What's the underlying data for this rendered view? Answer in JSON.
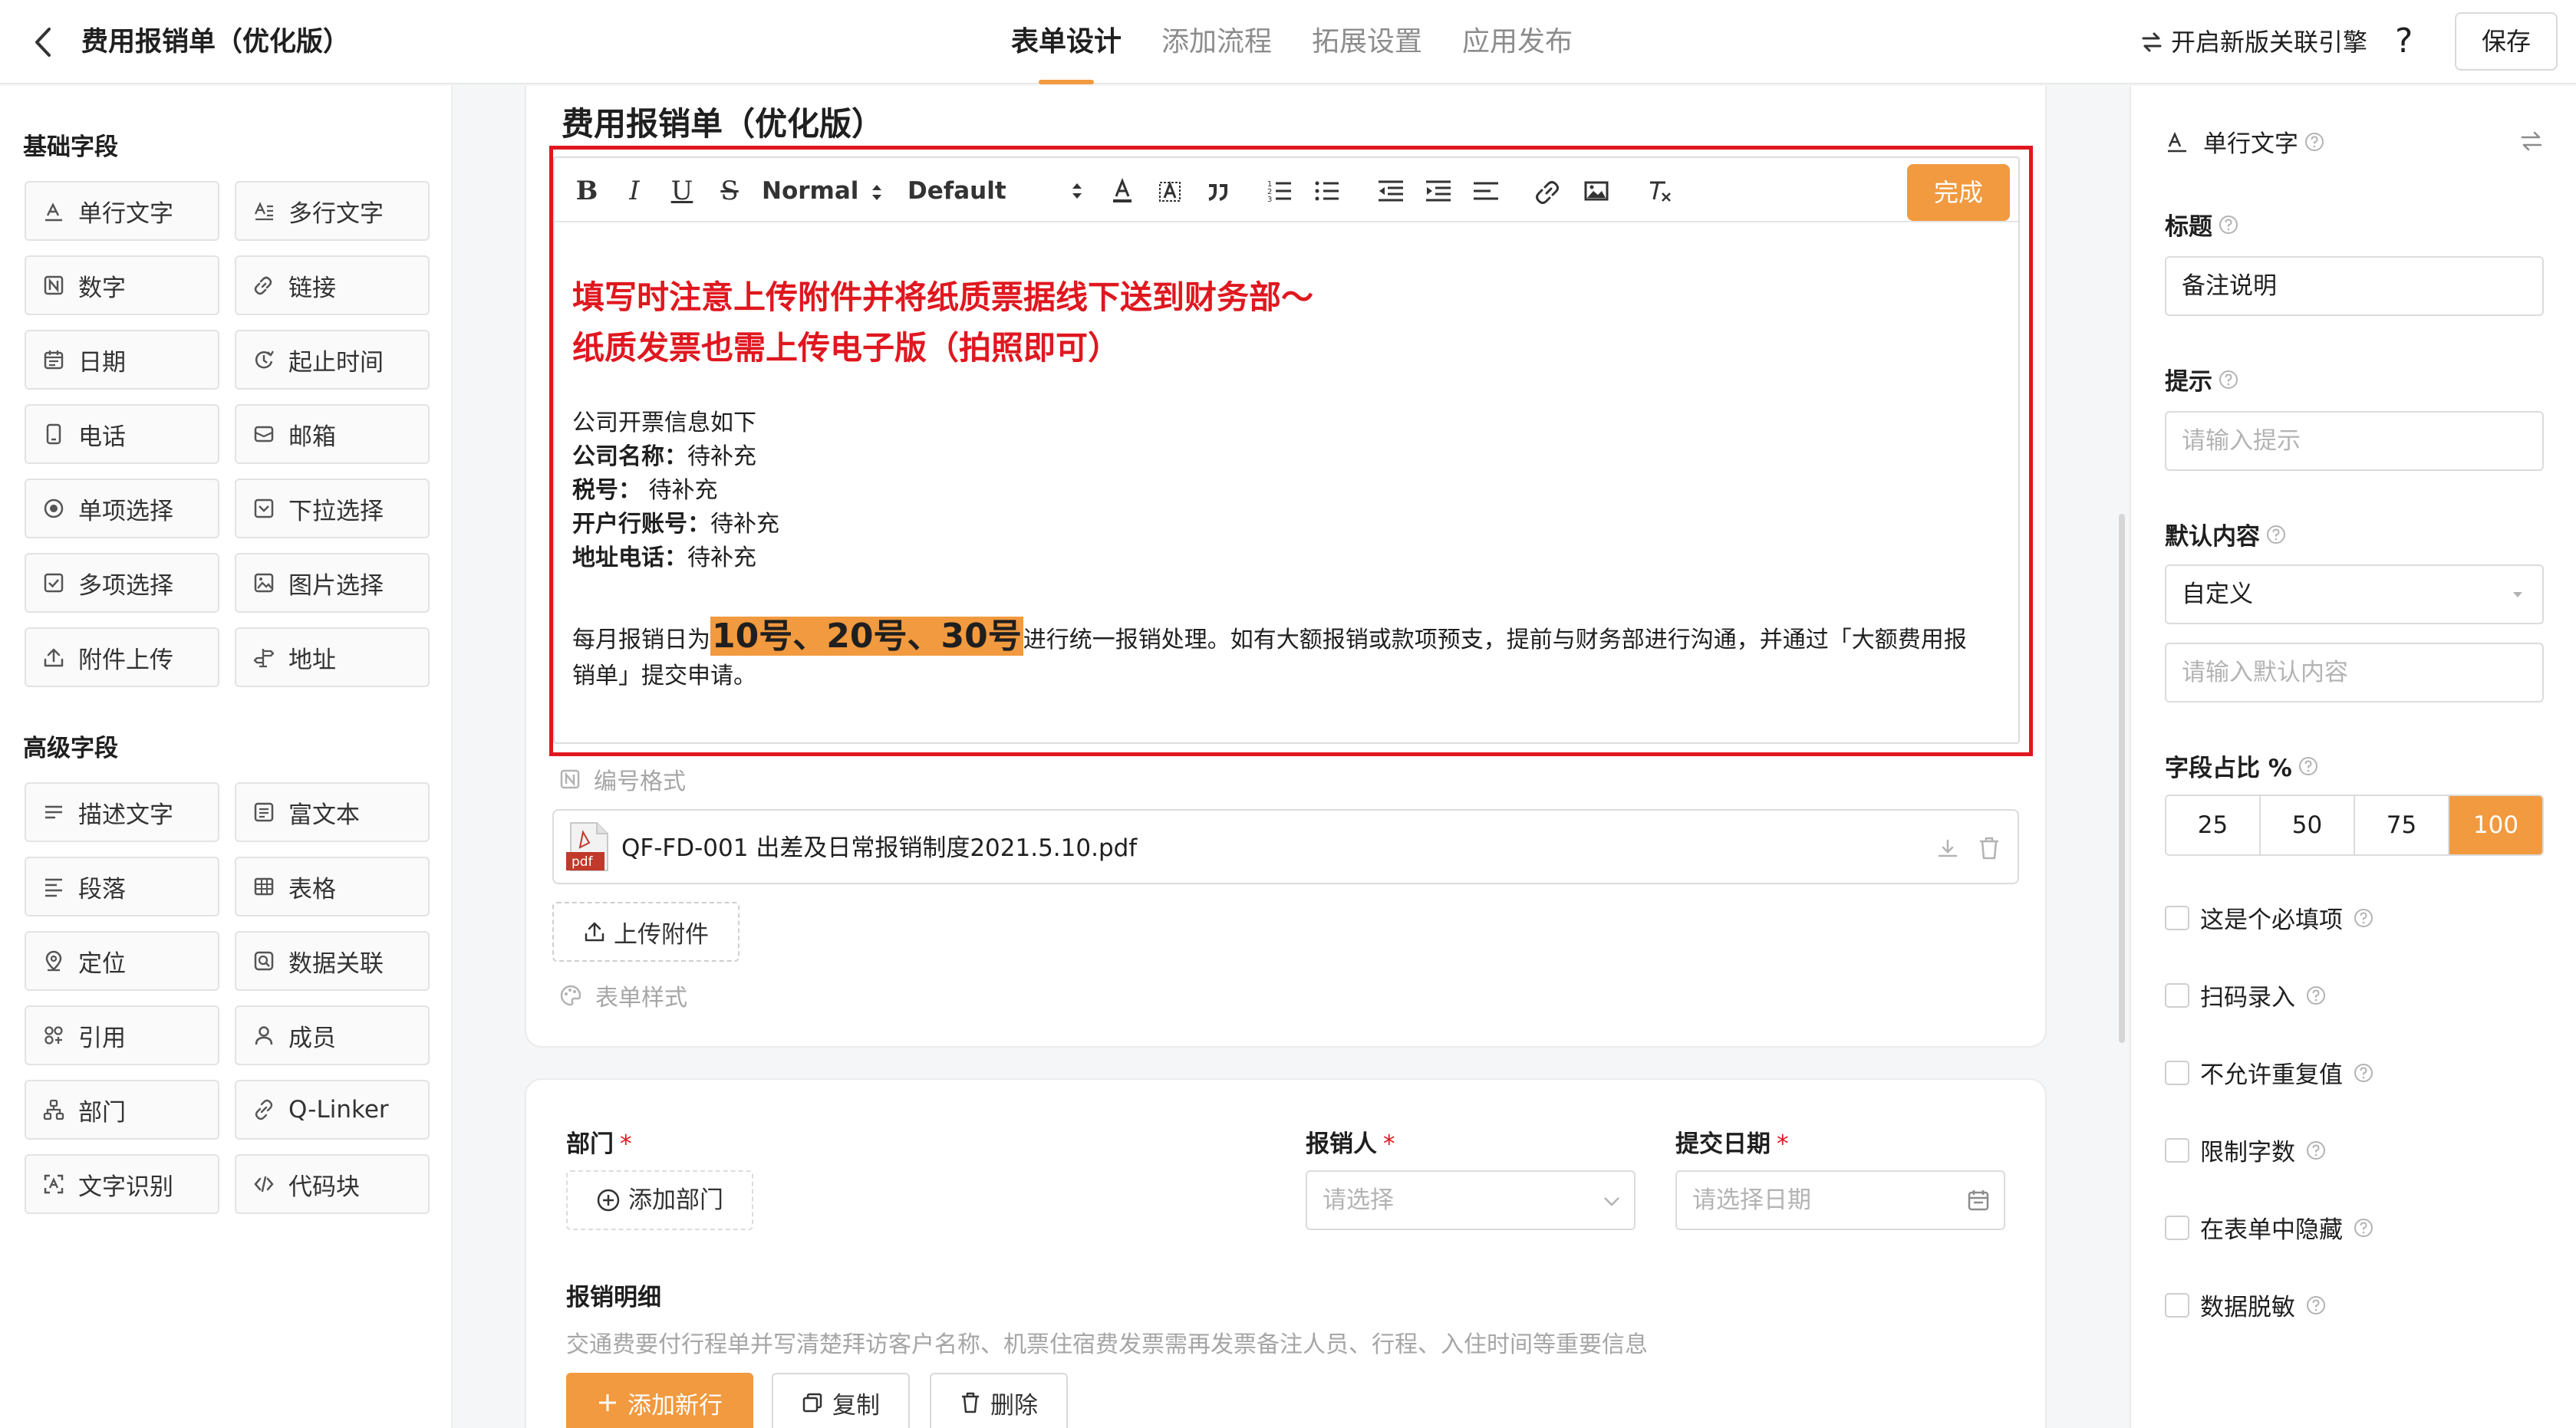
{
  "header": {
    "title": "费用报销单（优化版）",
    "tabs": [
      {
        "label": "表单设计"
      },
      {
        "label": "添加流程"
      },
      {
        "label": "拓展设置"
      },
      {
        "label": "应用发布"
      }
    ],
    "active_tab": 0,
    "engine_label": "开启新版关联引擎",
    "help_label": "?",
    "save_label": "保存"
  },
  "left_panel": {
    "basic_title": "基础字段",
    "basic_fields": [
      {
        "label": "单行文字",
        "icon": "single-line-text-icon"
      },
      {
        "label": "多行文字",
        "icon": "multi-line-text-icon"
      },
      {
        "label": "数字",
        "icon": "number-icon"
      },
      {
        "label": "链接",
        "icon": "link-icon"
      },
      {
        "label": "日期",
        "icon": "calendar-icon"
      },
      {
        "label": "起止时间",
        "icon": "time-range-icon"
      },
      {
        "label": "电话",
        "icon": "phone-icon"
      },
      {
        "label": "邮箱",
        "icon": "mail-icon"
      },
      {
        "label": "单项选择",
        "icon": "radio-icon"
      },
      {
        "label": "下拉选择",
        "icon": "dropdown-icon"
      },
      {
        "label": "多项选择",
        "icon": "checkbox-icon"
      },
      {
        "label": "图片选择",
        "icon": "image-icon"
      },
      {
        "label": "附件上传",
        "icon": "upload-icon"
      },
      {
        "label": "地址",
        "icon": "address-icon"
      }
    ],
    "advanced_title": "高级字段",
    "advanced_fields": [
      {
        "label": "描述文字",
        "icon": "description-icon"
      },
      {
        "label": "富文本",
        "icon": "rich-text-icon"
      },
      {
        "label": "段落",
        "icon": "paragraph-icon"
      },
      {
        "label": "表格",
        "icon": "table-icon"
      },
      {
        "label": "定位",
        "icon": "location-icon"
      },
      {
        "label": "数据关联",
        "icon": "data-link-icon"
      },
      {
        "label": "引用",
        "icon": "reference-icon"
      },
      {
        "label": "成员",
        "icon": "member-icon"
      },
      {
        "label": "部门",
        "icon": "department-icon"
      },
      {
        "label": "Q-Linker",
        "icon": "q-linker-icon"
      },
      {
        "label": "文字识别",
        "icon": "ocr-icon"
      },
      {
        "label": "代码块",
        "icon": "code-icon"
      }
    ]
  },
  "form": {
    "title": "费用报销单（优化版）",
    "toolbar": {
      "bold": "B",
      "italic": "I",
      "underline": "U",
      "strike": "S",
      "heading_select": "Normal",
      "font_select": "Default",
      "done_label": "完成"
    },
    "editor": {
      "red_line_1": "填写时注意上传附件并将纸质票据线下送到财务部～",
      "red_line_2": "纸质发票也需上传电子版（拍照即可）",
      "info_intro": "公司开票信息如下",
      "info_items": [
        {
          "key": "公司名称：",
          "value": "待补充"
        },
        {
          "key": "税号：",
          "value": " 待补充"
        },
        {
          "key": "开户行账号：",
          "value": "待补充"
        },
        {
          "key": "地址电话：",
          "value": "待补充"
        }
      ],
      "para_prefix": "每月报销日为",
      "para_highlight": "10号、20号、30号",
      "para_suffix": "进行统一报销处理。如有大额报销或款项预支，提前与财务部进行沟通，并通过「大额费用报",
      "para_line2": "销单」提交申请。"
    },
    "number_format_label": "编号格式",
    "attachment": {
      "badge": "pdf",
      "name": "QF-FD-001 出差及日常报销制度2021.5.10.pdf"
    },
    "upload_label": "上传附件",
    "form_style_label": "表单样式"
  },
  "fields_card": {
    "department_label": "部门",
    "add_department_label": "添加部门",
    "applicant_label": "报销人",
    "applicant_placeholder": "请选择",
    "date_label": "提交日期",
    "date_placeholder": "请选择日期",
    "detail_label": "报销明细",
    "detail_hint": "交通费要付行程单并写清楚拜访客户名称、机票住宿费发票需再发票备注人员、行程、入住时间等重要信息",
    "add_row_label": "添加新行",
    "copy_label": "复制",
    "delete_label": "删除",
    "required_mark": "*"
  },
  "right_panel": {
    "field_type": "单行文字",
    "title_label": "标题",
    "title_value": "备注说明",
    "hint_label": "提示",
    "hint_placeholder": "请输入提示",
    "default_label": "默认内容",
    "default_select": "自定义",
    "default_placeholder": "请输入默认内容",
    "ratio_label": "字段占比 %",
    "ratio_options": [
      "25",
      "50",
      "75",
      "100"
    ],
    "ratio_selected": "100",
    "checkboxes": [
      "这是个必填项",
      "扫码录入",
      "不允许重复值",
      "限制字数",
      "在表单中隐藏",
      "数据脱敏"
    ]
  },
  "colors": {
    "accent": "#f29a3f",
    "highlight_red": "#e0171f"
  }
}
